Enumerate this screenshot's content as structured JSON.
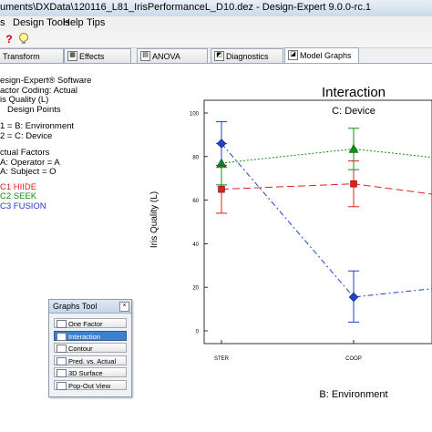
{
  "window": {
    "title": "uments\\DXData\\120116_L81_IrisPerformanceL_D10.dez - Design-Expert 9.0.0-rc.1"
  },
  "menu": [
    "s",
    "Design Tools",
    "Help",
    "Tips"
  ],
  "toolbar": {
    "help_glyph": "?",
    "tip_icon": "lightbulb-icon"
  },
  "tabs": [
    {
      "label": "Transform",
      "icon": "transform-icon"
    },
    {
      "label": "Effects",
      "icon": "effects-icon"
    },
    {
      "label": "ANOVA",
      "icon": "anova-icon"
    },
    {
      "label": "Diagnostics",
      "icon": "diagnostics-icon"
    },
    {
      "label": "Model Graphs",
      "icon": "model-graphs-icon",
      "active": true
    }
  ],
  "info": {
    "software": "esign-Expert® Software",
    "coding": "actor Coding: Actual",
    "response": "is Quality (L)",
    "points": "Design Points",
    "x1": "1 = B: Environment",
    "x2": "2 = C: Device",
    "actual_header": "ctual Factors",
    "actual_a": "A: Operator = A",
    "actual_b": "A: Subject = O",
    "legend": [
      {
        "label": "C1 HIIDE",
        "color": "#e02020"
      },
      {
        "label": "C2 SEEK",
        "color": "#109010"
      },
      {
        "label": "C3 FUSION",
        "color": "#2040d0"
      }
    ]
  },
  "graphs_tool": {
    "title": "Graphs Tool",
    "buttons": [
      {
        "label": "One Factor",
        "selected": false
      },
      {
        "label": "Interaction",
        "selected": true
      },
      {
        "label": "Contour",
        "selected": false
      },
      {
        "label": "Pred. vs. Actual",
        "selected": false
      },
      {
        "label": "3D Surface",
        "selected": false
      },
      {
        "label": "Pop-Out View",
        "selected": false
      }
    ]
  },
  "chart_data": {
    "type": "line",
    "title": "Interaction",
    "subtitle": "C: Device",
    "xlabel": "B: Environment",
    "ylabel": "Iris Quality (L)",
    "categories": [
      "STER",
      "COOP",
      ""
    ],
    "ylim": [
      0,
      100
    ],
    "yticks": [
      0,
      20,
      40,
      60,
      80,
      100
    ],
    "series": [
      {
        "name": "C1 HIIDE",
        "color": "#e02020",
        "marker": "square",
        "values": [
          65,
          67.5,
          59.5
        ],
        "err_low": [
          54,
          57
        ],
        "err_high": [
          75,
          78
        ]
      },
      {
        "name": "C2 SEEK",
        "color": "#109010",
        "marker": "triangle",
        "values": [
          77,
          83.5,
          77
        ],
        "err_low": [
          67,
          74
        ],
        "err_high": [
          86,
          93
        ]
      },
      {
        "name": "C3 FUSION",
        "color": "#2040d0",
        "marker": "diamond",
        "values": [
          86,
          15.5,
          22
        ],
        "err_low": [
          76,
          4
        ],
        "err_high": [
          96,
          27.5
        ]
      }
    ]
  }
}
